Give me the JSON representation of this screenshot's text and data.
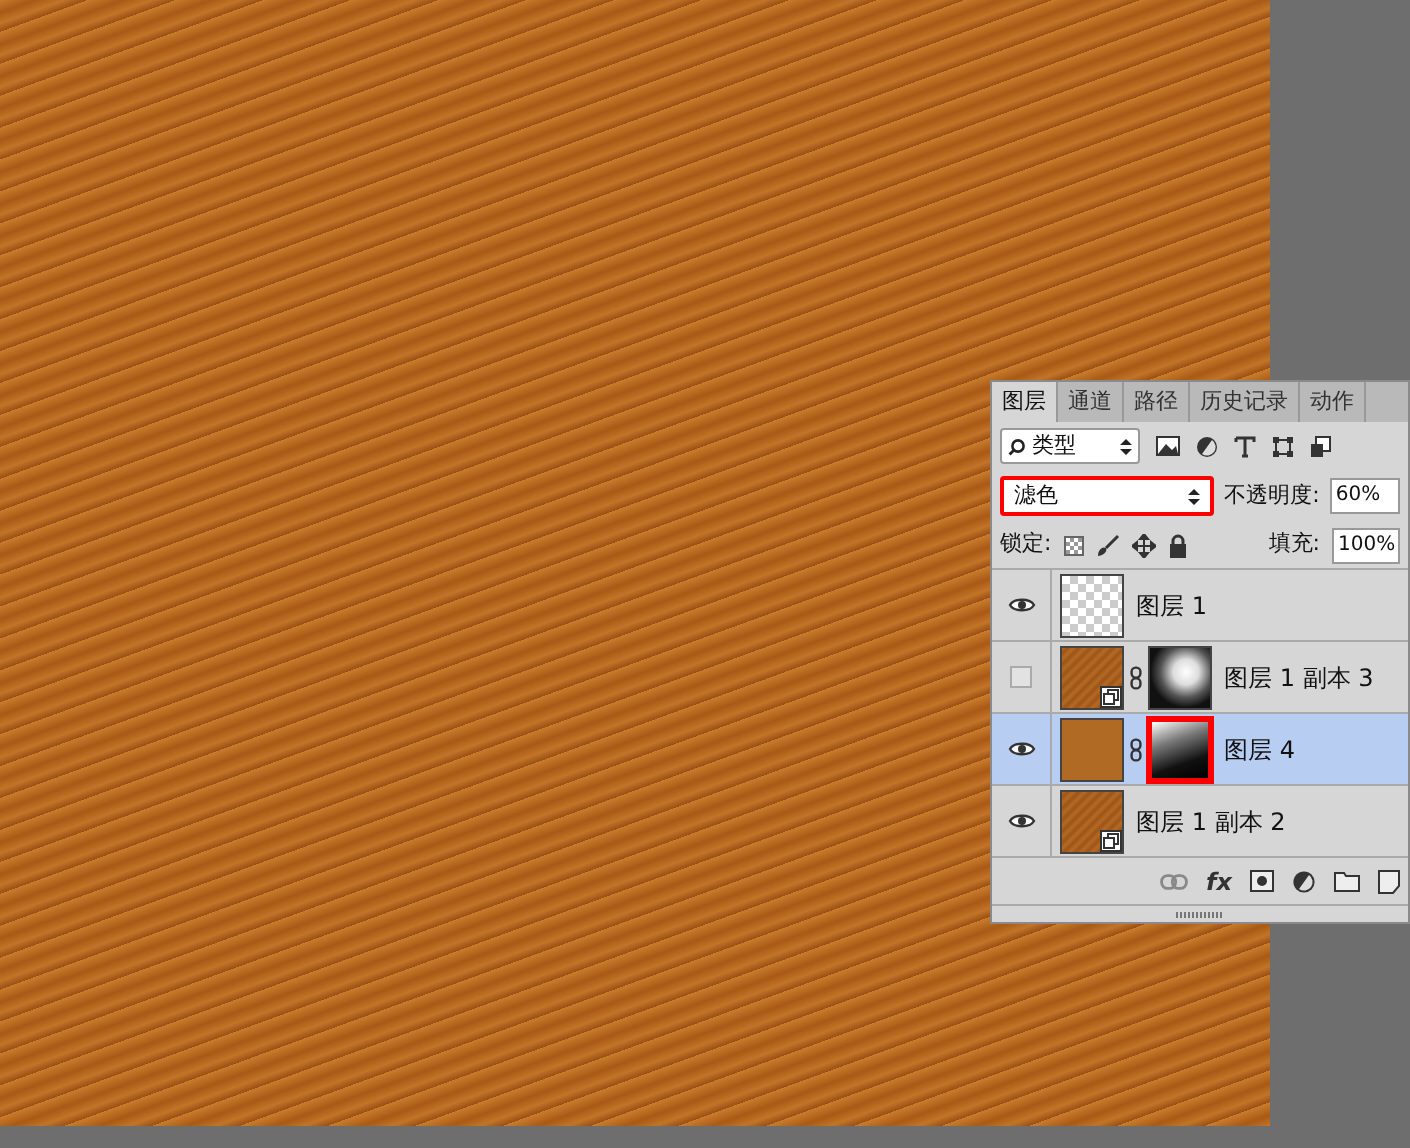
{
  "panel": {
    "tabs": [
      {
        "label": "图层",
        "selected": true
      },
      {
        "label": "通道",
        "selected": false
      },
      {
        "label": "路径",
        "selected": false
      },
      {
        "label": "历史记录",
        "selected": false
      },
      {
        "label": "动作",
        "selected": false
      }
    ],
    "filter": {
      "value": "类型"
    },
    "blend_mode": {
      "value": "滤色",
      "highlighted": true
    },
    "opacity": {
      "label": "不透明度:",
      "value": "60%"
    },
    "lock": {
      "label": "锁定:"
    },
    "fill": {
      "label": "填充:",
      "value": "100%"
    },
    "layers": [
      {
        "name": "图层 1",
        "visible": true,
        "selected": false,
        "thumbnail": {
          "kind": "transparent",
          "smart": false
        }
      },
      {
        "name": "图层 1 副本 3",
        "visible": false,
        "selected": false,
        "thumbnail": {
          "kind": "wood",
          "smart": true
        },
        "mask": {
          "kind": "clouds",
          "highlighted": false
        }
      },
      {
        "name": "图层 4",
        "visible": true,
        "selected": true,
        "thumbnail": {
          "kind": "solid",
          "smart": false
        },
        "mask": {
          "kind": "gradient",
          "highlighted": true
        }
      },
      {
        "name": "图层 1 副本 2",
        "visible": true,
        "selected": false,
        "thumbnail": {
          "kind": "wood",
          "smart": true
        }
      }
    ],
    "fx_label": "fx"
  }
}
